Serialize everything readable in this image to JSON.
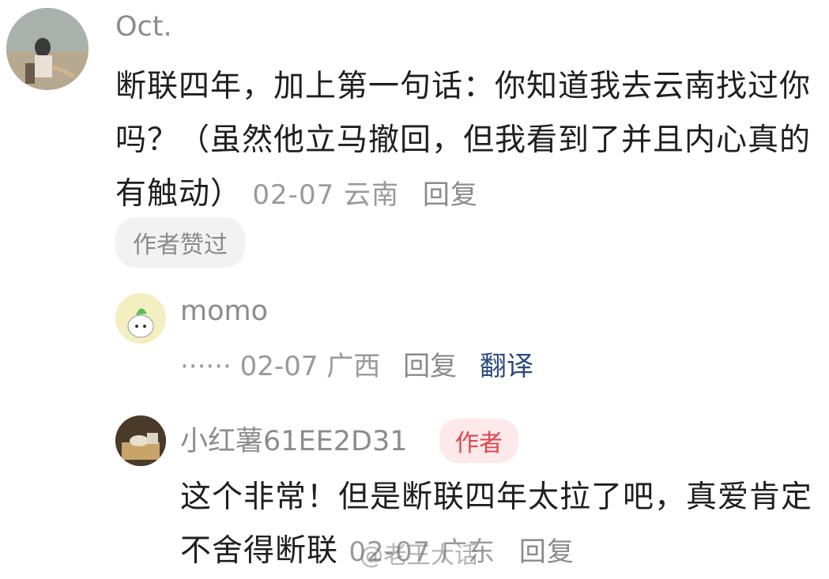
{
  "main_comment": {
    "username": "Oct.",
    "text": "断联四年，加上第一句话：你知道我去云南找过你吗？（虽然他立马撤回，但我看到了并且内心真的有触动）",
    "date": "02-07",
    "location": "云南",
    "reply_label": "回复",
    "liked_tag": "作者赞过"
  },
  "replies": [
    {
      "username": "momo",
      "text": "······",
      "date": "02-07",
      "location": "广西",
      "reply_label": "回复",
      "translate_label": "翻译"
    },
    {
      "username": "小红薯61EE2D31",
      "badge": "作者",
      "text": "这个非常！但是断联四年太拉了吧，真爱肯定不舍得断联",
      "date": "02-07",
      "location": "广东",
      "reply_label": "回复"
    }
  ],
  "watermark": "@老王大话",
  "colors": {
    "author_badge_bg": "#fde9ea",
    "author_badge_text": "#e0454f",
    "translate_link": "#2b4a7d"
  }
}
